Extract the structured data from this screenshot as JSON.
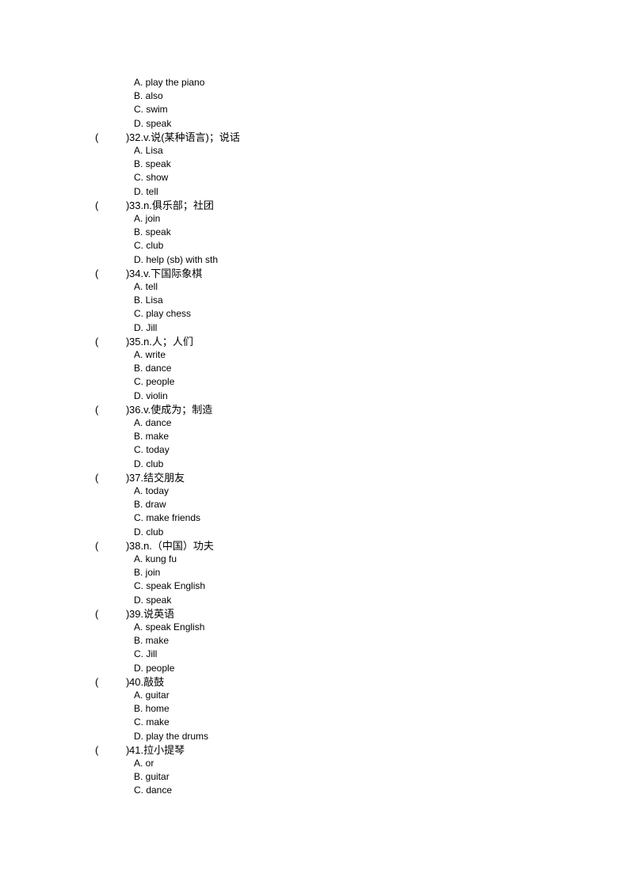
{
  "prev_options": [
    "A. play the piano",
    "B. also",
    "C. swim",
    "D. speak"
  ],
  "questions": [
    {
      "number": "32",
      "prompt": "32.v.说(某种语言)；说话",
      "options": [
        "A. Lisa",
        "B. speak",
        "C. show",
        "D. tell"
      ]
    },
    {
      "number": "33",
      "prompt": "33.n.俱乐部；社团",
      "options": [
        "A. join",
        "B. speak",
        "C. club",
        "D. help (sb) with sth"
      ]
    },
    {
      "number": "34",
      "prompt": "34.v.下国际象棋",
      "options": [
        "A. tell",
        "B. Lisa",
        "C. play chess",
        "D. Jill"
      ]
    },
    {
      "number": "35",
      "prompt": "35.n.人；人们",
      "options": [
        "A. write",
        "B. dance",
        "C. people",
        "D. violin"
      ]
    },
    {
      "number": "36",
      "prompt": "36.v.使成为；制造",
      "options": [
        "A. dance",
        "B. make",
        "C. today",
        "D. club"
      ]
    },
    {
      "number": "37",
      "prompt": "37.结交朋友",
      "options": [
        "A. today",
        "B. draw",
        "C. make friends",
        "D. club"
      ]
    },
    {
      "number": "38",
      "prompt": "38.n.（中国）功夫",
      "options": [
        "A. kung fu",
        "B. join",
        "C. speak English",
        "D. speak"
      ]
    },
    {
      "number": "39",
      "prompt": "39.说英语",
      "options": [
        "A. speak English",
        "B. make",
        "C. Jill",
        "D. people"
      ]
    },
    {
      "number": "40",
      "prompt": "40.敲鼓",
      "options": [
        "A. guitar",
        "B. home",
        "C. make",
        "D. play the drums"
      ]
    },
    {
      "number": "41",
      "prompt": "41.拉小提琴",
      "options": [
        "A. or",
        "B. guitar",
        "C. dance"
      ]
    }
  ],
  "paren_open": "(",
  "paren_close": ")"
}
